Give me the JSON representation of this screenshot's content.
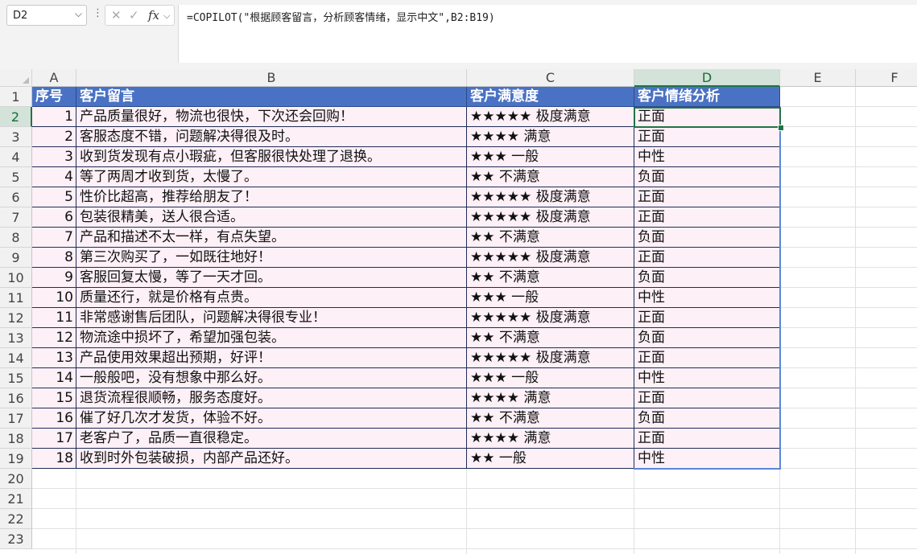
{
  "namebox": {
    "value": "D2"
  },
  "formula": {
    "text": "=COPILOT(\"根据顾客留言，分析顾客情绪，显示中文\",B2:B19)"
  },
  "icons": {
    "cancel": "✕",
    "enter": "✓",
    "fx": "fx",
    "chevron": "⌵",
    "dots": "⋮"
  },
  "columns": [
    "A",
    "B",
    "C",
    "D",
    "E",
    "F"
  ],
  "rows": [
    "1",
    "2",
    "3",
    "4",
    "5",
    "6",
    "7",
    "8",
    "9",
    "10",
    "11",
    "12",
    "13",
    "14",
    "15",
    "16",
    "17",
    "18",
    "19",
    "20",
    "21",
    "22",
    "23"
  ],
  "table": {
    "headers": [
      "序号",
      "客户留言",
      "客户满意度",
      "客户情绪分析"
    ],
    "rows": [
      [
        "1",
        "产品质量很好，物流也很快，下次还会回购！",
        "★★★★★ 极度满意",
        "正面"
      ],
      [
        "2",
        "客服态度不错，问题解决得很及时。",
        "★★★★ 满意",
        "正面"
      ],
      [
        "3",
        "收到货发现有点小瑕疵，但客服很快处理了退换。",
        "★★★ 一般",
        "中性"
      ],
      [
        "4",
        "等了两周才收到货，太慢了。",
        "★★ 不满意",
        "负面"
      ],
      [
        "5",
        "性价比超高，推荐给朋友了！",
        "★★★★★ 极度满意",
        "正面"
      ],
      [
        "6",
        "包装很精美，送人很合适。",
        "★★★★★ 极度满意",
        "正面"
      ],
      [
        "7",
        "产品和描述不太一样，有点失望。",
        "★★ 不满意",
        "负面"
      ],
      [
        "8",
        "第三次购买了，一如既往地好！",
        "★★★★★ 极度满意",
        "正面"
      ],
      [
        "9",
        "客服回复太慢，等了一天才回。",
        "★★ 不满意",
        "负面"
      ],
      [
        "10",
        "质量还行，就是价格有点贵。",
        "★★★ 一般",
        "中性"
      ],
      [
        "11",
        "非常感谢售后团队，问题解决得很专业！",
        "★★★★★ 极度满意",
        "正面"
      ],
      [
        "12",
        "物流途中损坏了，希望加强包装。",
        "★★ 不满意",
        "负面"
      ],
      [
        "13",
        "产品使用效果超出预期，好评！",
        "★★★★★ 极度满意",
        "正面"
      ],
      [
        "14",
        "一般般吧，没有想象中那么好。",
        "★★★ 一般",
        "中性"
      ],
      [
        "15",
        "退货流程很顺畅，服务态度好。",
        "★★★★ 满意",
        "正面"
      ],
      [
        "16",
        "催了好几次才发货，体验不好。",
        "★★ 不满意",
        "负面"
      ],
      [
        "17",
        "老客户了，品质一直很稳定。",
        "★★★★ 满意",
        "正面"
      ],
      [
        "18",
        "收到时外包装破损，内部产品还好。",
        "★★ 一般",
        "中性"
      ]
    ]
  }
}
